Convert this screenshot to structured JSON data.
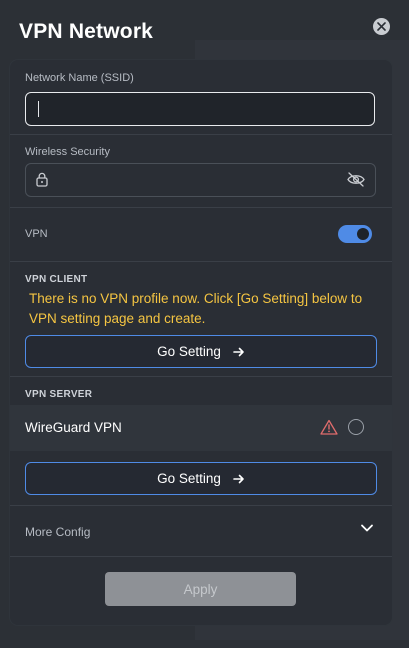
{
  "dialog": {
    "title": "VPN Network"
  },
  "ssid": {
    "label": "Network Name (SSID)",
    "value": ""
  },
  "security": {
    "label": "Wireless Security",
    "value": ""
  },
  "vpn": {
    "label": "VPN",
    "enabled": true
  },
  "vpn_client": {
    "heading": "VPN CLIENT",
    "message": "There is no VPN profile now. Click [Go Setting] below to VPN setting page and create.",
    "button_label": "Go Setting"
  },
  "vpn_server": {
    "heading": "VPN SERVER",
    "item_label": "WireGuard VPN",
    "button_label": "Go Setting"
  },
  "more_config": {
    "label": "More Config"
  },
  "apply": {
    "label": "Apply"
  },
  "colors": {
    "accent": "#4f8be6",
    "warning_text": "#f5c542",
    "alert_icon": "#e06c6c"
  }
}
